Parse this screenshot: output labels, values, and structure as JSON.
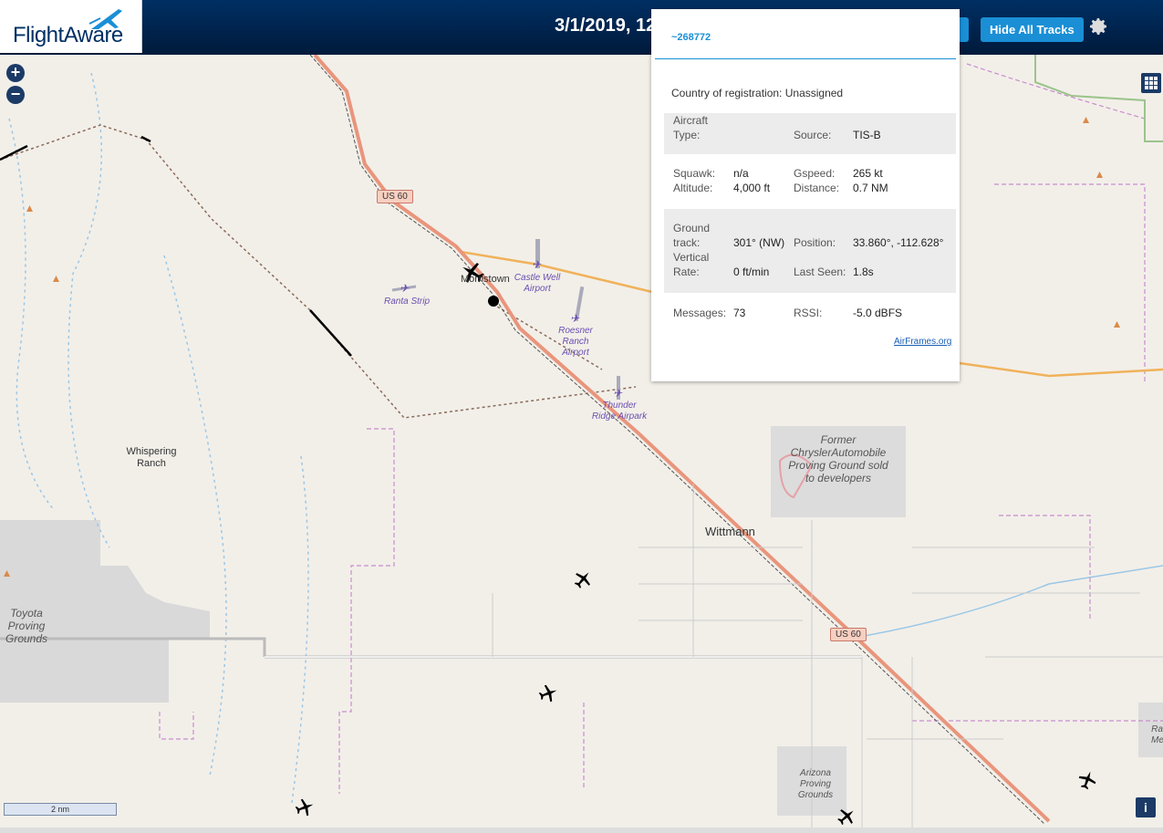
{
  "header": {
    "logo_text": "FlightAware",
    "date_text": "3/1/2019, 12",
    "hide_tracks_label": "Hide All Tracks",
    "settings_icon": "gear-icon"
  },
  "map": {
    "zoom_in": "+",
    "zoom_out": "−",
    "places": {
      "morristown": "Morristown",
      "wittmann": "Wittmann",
      "whispering_ranch": "Whispering Ranch",
      "toyota_proving": "Toyota Proving Grounds",
      "former_chrysler": "Former ChryslerAutomobile Proving Ground sold to developers",
      "arizona_proving": "Arizona Proving Grounds",
      "ranta_strip": "Ranta Strip",
      "castle_well": "Castle Well Airport",
      "roesner_ranch": "Roesner Ranch Airport",
      "thunder_ridge": "Thunder Ridge Airpark",
      "ra_partial": "Ra Me"
    },
    "route_shield_1": "US 60",
    "route_shield_2": "US 60",
    "scale_label": "2 nm",
    "info_label": "i"
  },
  "popup": {
    "title": "~268772",
    "country_label": "Country of registration:",
    "country_value": "Unassigned",
    "aircraft_type_label": "Aircraft Type:",
    "aircraft_type_value": "",
    "source_label": "Source:",
    "source_value": "TIS-B",
    "squawk_label": "Squawk:",
    "squawk_value": "n/a",
    "altitude_label": "Altitude:",
    "altitude_value": "4,000 ft",
    "gspeed_label": "Gspeed:",
    "gspeed_value": "265 kt",
    "distance_label": "Distance:",
    "distance_value": "0.7 NM",
    "ground_track_label": "Ground track:",
    "ground_track_value": "301° (NW)",
    "position_label": "Position:",
    "position_value": "33.860°, -112.628°",
    "vertical_rate_label": "Vertical Rate:",
    "vertical_rate_value": "0 ft/min",
    "last_seen_label": "Last Seen:",
    "last_seen_value": "1.8s",
    "messages_label": "Messages:",
    "messages_value": "73",
    "rssi_label": "RSSI:",
    "rssi_value": "-5.0 dBFS",
    "airframes_link": "AirFrames.org"
  }
}
